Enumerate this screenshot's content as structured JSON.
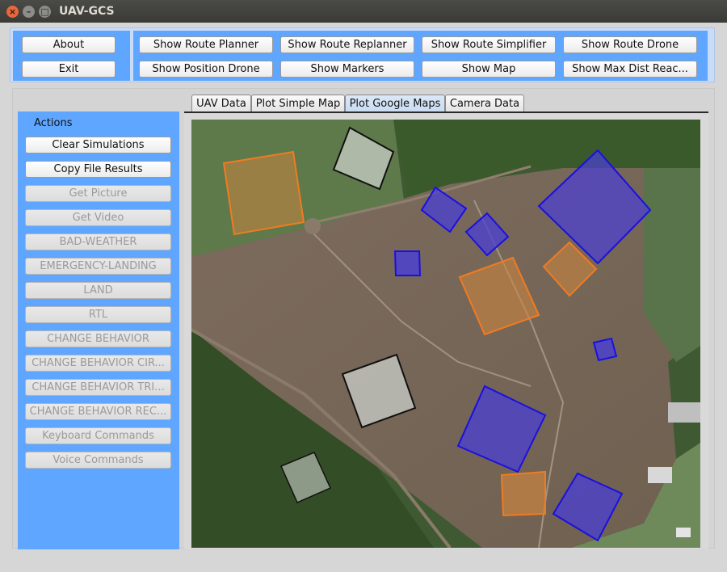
{
  "window": {
    "title": "UAV-GCS",
    "controls": {
      "close": "×",
      "minimize": "–",
      "maximize": "□"
    }
  },
  "toolbar": {
    "left_buttons": [
      {
        "label": "About"
      },
      {
        "label": "Exit"
      }
    ],
    "right_buttons": [
      {
        "label": "Show Route Planner"
      },
      {
        "label": "Show Route Replanner"
      },
      {
        "label": "Show Route Simplifier"
      },
      {
        "label": "Show Route Drone"
      },
      {
        "label": "Show Position Drone"
      },
      {
        "label": "Show Markers"
      },
      {
        "label": "Show Map"
      },
      {
        "label": "Show Max Dist Reac..."
      }
    ]
  },
  "sidebar": {
    "title": "Actions",
    "buttons": [
      {
        "label": "Clear Simulations",
        "enabled": true
      },
      {
        "label": "Copy File Results",
        "enabled": true
      },
      {
        "label": "Get Picture",
        "enabled": false
      },
      {
        "label": "Get Video",
        "enabled": false
      },
      {
        "label": "BAD-WEATHER",
        "enabled": false
      },
      {
        "label": "EMERGENCY-LANDING",
        "enabled": false
      },
      {
        "label": "LAND",
        "enabled": false
      },
      {
        "label": "RTL",
        "enabled": false
      },
      {
        "label": "CHANGE BEHAVIOR",
        "enabled": false
      },
      {
        "label": "CHANGE BEHAVIOR CIR...",
        "enabled": false
      },
      {
        "label": "CHANGE BEHAVIOR TRI...",
        "enabled": false
      },
      {
        "label": "CHANGE BEHAVIOR REC...",
        "enabled": false
      },
      {
        "label": "Keyboard Commands",
        "enabled": false
      },
      {
        "label": "Voice Commands",
        "enabled": false
      }
    ]
  },
  "tabs": [
    {
      "label": "UAV Data",
      "active": false
    },
    {
      "label": "Plot Simple Map",
      "active": false
    },
    {
      "label": "Plot Google Maps",
      "active": true
    },
    {
      "label": "Camera Data",
      "active": false
    }
  ],
  "colors": {
    "panel_blue": "#5ea6ff",
    "region_blue_fill": "#4a3fd6",
    "region_blue_stroke": "#1a10e0",
    "region_orange_fill": "#c98440",
    "region_orange_stroke": "#f07b22",
    "region_gray_fill": "#c9cfc8",
    "region_gray_stroke": "#111111"
  }
}
